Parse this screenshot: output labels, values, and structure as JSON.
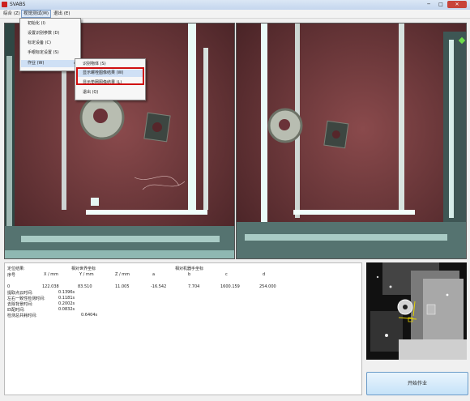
{
  "window": {
    "title": "SVABS",
    "minimize": "─",
    "maximize": "□",
    "close": "✕"
  },
  "menubar": [
    "综合 (Z)",
    "视觉测试(M)",
    "退出 (E)"
  ],
  "menu_main": {
    "items": [
      {
        "label": "初始化 (I)"
      },
      {
        "label": "设置识别参数 (D)"
      },
      {
        "label": "标定设备 (C)"
      },
      {
        "label": "手眼标定设置 (S)"
      },
      {
        "label": "作业 (W)"
      }
    ]
  },
  "menu_sub": {
    "items": [
      {
        "label": "识别物体 (S)"
      },
      {
        "label": "显示螺栓图像结果 (W)"
      },
      {
        "label": "显示垫圈图像结果 (L)"
      },
      {
        "label": "退出 (Q)"
      }
    ]
  },
  "info": {
    "line1_left": "定位结果:",
    "line1_mid": "相对世界坐标",
    "line1_right": "相对机器手坐标",
    "headers": [
      "序号",
      "X / mm",
      "Y / mm",
      "Z / mm",
      "a",
      "b",
      "c",
      "d"
    ],
    "row": [
      "0",
      "122.038",
      "83.510",
      "11.005",
      "-16.542",
      "7.704",
      "1600.159",
      "254.000"
    ],
    "stats": [
      {
        "label": "提取点云时间:",
        "value": "0.1396s"
      },
      {
        "label": "左右一致性检测时间:",
        "value": "0.1181s"
      },
      {
        "label": "去除背景时间:",
        "value": "0.2002s"
      },
      {
        "label": "匹配时间:",
        "value": "0.0832s"
      },
      {
        "label": "检测总共耗时间:",
        "value": "0.6404s"
      }
    ]
  },
  "start_button": "开始作业"
}
